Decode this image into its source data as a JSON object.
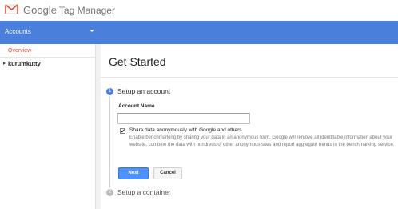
{
  "header": {
    "brand_google": "Google",
    "brand_product": "Tag Manager",
    "logo_icon": "tag-manager-logo-icon"
  },
  "nav": {
    "accounts_label": "Accounts",
    "caret_icon": "caret-down-icon",
    "bar_color": "#4a80dc"
  },
  "sidebar": {
    "overview_label": "Overview",
    "account_name": "kurumkutty",
    "account_icon": "triangle-right-icon"
  },
  "main": {
    "title": "Get Started",
    "steps": [
      {
        "number": "1",
        "label": "Setup an account",
        "active": true
      },
      {
        "number": "2",
        "label": "Setup a container",
        "active": false
      }
    ],
    "form": {
      "account_name_label": "Account Name",
      "account_name_value": "",
      "share_checked": true,
      "share_label": "Share data anonymously with Google and others",
      "share_description": "Enable benchmarking by sharing your data in an anonymous form. Google will remove all identifiable information about your website, combine the data with hundreds of other anonymous sites and report aggregate trends in the benchmarking service.",
      "next_button": "Next",
      "cancel_button": "Cancel"
    }
  },
  "colors": {
    "accent": "#4a80dc",
    "overview_link": "#dd4b39",
    "primary_button": "#4d90fe"
  }
}
